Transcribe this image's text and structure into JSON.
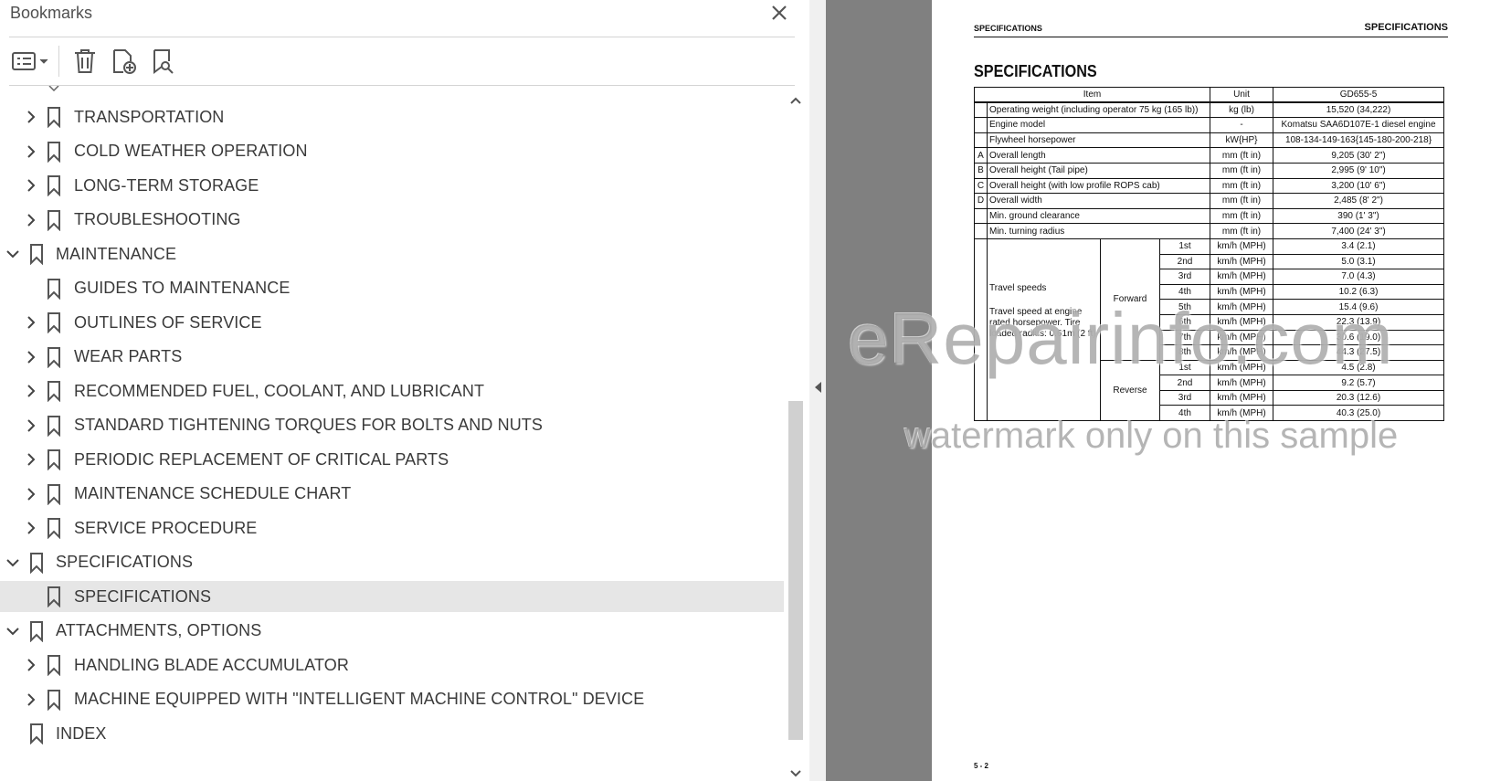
{
  "bookmarks_panel": {
    "title": "Bookmarks",
    "items": [
      {
        "label": "TRANSPORTATION",
        "level": 1,
        "expandable": true,
        "expanded": false,
        "selected": false
      },
      {
        "label": "COLD WEATHER OPERATION",
        "level": 1,
        "expandable": true,
        "expanded": false,
        "selected": false
      },
      {
        "label": "LONG-TERM STORAGE",
        "level": 1,
        "expandable": true,
        "expanded": false,
        "selected": false
      },
      {
        "label": "TROUBLESHOOTING",
        "level": 1,
        "expandable": true,
        "expanded": false,
        "selected": false
      },
      {
        "label": "MAINTENANCE",
        "level": 0,
        "expandable": true,
        "expanded": true,
        "selected": false
      },
      {
        "label": "GUIDES TO MAINTENANCE",
        "level": 1,
        "expandable": false,
        "expanded": false,
        "selected": false
      },
      {
        "label": "OUTLINES OF SERVICE",
        "level": 1,
        "expandable": true,
        "expanded": false,
        "selected": false
      },
      {
        "label": "WEAR PARTS",
        "level": 1,
        "expandable": true,
        "expanded": false,
        "selected": false
      },
      {
        "label": "RECOMMENDED FUEL, COOLANT, AND LUBRICANT",
        "level": 1,
        "expandable": true,
        "expanded": false,
        "selected": false
      },
      {
        "label": "STANDARD TIGHTENING TORQUES FOR BOLTS AND NUTS",
        "level": 1,
        "expandable": true,
        "expanded": false,
        "selected": false
      },
      {
        "label": "PERIODIC REPLACEMENT OF CRITICAL PARTS",
        "level": 1,
        "expandable": true,
        "expanded": false,
        "selected": false
      },
      {
        "label": "MAINTENANCE SCHEDULE CHART",
        "level": 1,
        "expandable": true,
        "expanded": false,
        "selected": false
      },
      {
        "label": "SERVICE PROCEDURE",
        "level": 1,
        "expandable": true,
        "expanded": false,
        "selected": false
      },
      {
        "label": "SPECIFICATIONS",
        "level": 0,
        "expandable": true,
        "expanded": true,
        "selected": false
      },
      {
        "label": "SPECIFICATIONS",
        "level": 1,
        "expandable": false,
        "expanded": false,
        "selected": true
      },
      {
        "label": "ATTACHMENTS, OPTIONS",
        "level": 0,
        "expandable": true,
        "expanded": true,
        "selected": false
      },
      {
        "label": "HANDLING BLADE ACCUMULATOR",
        "level": 1,
        "expandable": true,
        "expanded": false,
        "selected": false
      },
      {
        "label": "MACHINE EQUIPPED WITH \"INTELLIGENT MACHINE CONTROL\" DEVICE",
        "level": 1,
        "expandable": true,
        "expanded": false,
        "selected": false
      },
      {
        "label": "INDEX",
        "level": 0,
        "expandable": false,
        "expanded": false,
        "selected": false
      }
    ],
    "scroll_position": 0.45,
    "scroll_visible_fraction": 0.52,
    "colors": {
      "selected_bg": "#e6e6e6",
      "text": "#3a3a3a",
      "icon": "#555555"
    }
  },
  "document": {
    "header_left": "SPECIFICATIONS",
    "header_right": "SPECIFICATIONS",
    "title": "SPECIFICATIONS",
    "page_number": "5 - 2",
    "table": {
      "headers": [
        "Item",
        "Unit",
        "GD655-5"
      ],
      "rows": [
        {
          "code": "",
          "item": "Operating weight (including operator 75 kg (165 lb))",
          "unit": "kg (lb)",
          "value": "15,520 (34,222)"
        },
        {
          "code": "",
          "item": "Engine model",
          "unit": "-",
          "value": "Komatsu SAA6D107E-1 diesel engine"
        },
        {
          "code": "",
          "item": "Flywheel horsepower",
          "unit": "kW{HP}",
          "value": "108-134-149-163{145-180-200-218}"
        },
        {
          "code": "A",
          "item": "Overall length",
          "unit": "mm (ft in)",
          "value": "9,205 (30' 2\")"
        },
        {
          "code": "B",
          "item": "Overall height (Tail pipe)",
          "unit": "mm (ft in)",
          "value": "2,995 (9' 10\")"
        },
        {
          "code": "C",
          "item": "Overall height (with low profile ROPS cab)",
          "unit": "mm (ft in)",
          "value": "3,200 (10' 6\")"
        },
        {
          "code": "D",
          "item": "Overall width",
          "unit": "mm (ft in)",
          "value": "2,485 (8' 2\")"
        },
        {
          "code": "",
          "item": "Min. ground clearance",
          "unit": "mm (ft in)",
          "value": "390 (1' 3\")"
        },
        {
          "code": "",
          "item": "Min. turning radius",
          "unit": "mm (ft in)",
          "value": "7,400 (24' 3\")"
        }
      ],
      "travel": {
        "label": "Travel speeds",
        "note": "Travel speed at engine rated horsepower. Tire loaded radius: 0.61m (2 ft)",
        "forward_label": "Forward",
        "reverse_label": "Reverse",
        "forward": [
          {
            "gear": "1st",
            "unit": "km/h (MPH)",
            "value": "3.4 (2.1)"
          },
          {
            "gear": "2nd",
            "unit": "km/h (MPH)",
            "value": "5.0 (3.1)"
          },
          {
            "gear": "3rd",
            "unit": "km/h (MPH)",
            "value": "7.0 (4.3)"
          },
          {
            "gear": "4th",
            "unit": "km/h (MPH)",
            "value": "10.2 (6.3)"
          },
          {
            "gear": "5th",
            "unit": "km/h (MPH)",
            "value": "15.4 (9.6)"
          },
          {
            "gear": "6th",
            "unit": "km/h (MPH)",
            "value": "22.3 (13.9)"
          },
          {
            "gear": "7th",
            "unit": "km/h (MPH)",
            "value": "30.6 (19.0)"
          },
          {
            "gear": "8th",
            "unit": "km/h (MPH)",
            "value": "44.3 (27.5)"
          }
        ],
        "reverse": [
          {
            "gear": "1st",
            "unit": "km/h (MPH)",
            "value": "4.5 (2.8)"
          },
          {
            "gear": "2nd",
            "unit": "km/h (MPH)",
            "value": "9.2 (5.7)"
          },
          {
            "gear": "3rd",
            "unit": "km/h (MPH)",
            "value": "20.3 (12.6)"
          },
          {
            "gear": "4th",
            "unit": "km/h (MPH)",
            "value": "40.3 (25.0)"
          }
        ]
      }
    },
    "watermark_main": "eRepairinfo.com",
    "watermark_sub": "watermark only on this sample"
  }
}
